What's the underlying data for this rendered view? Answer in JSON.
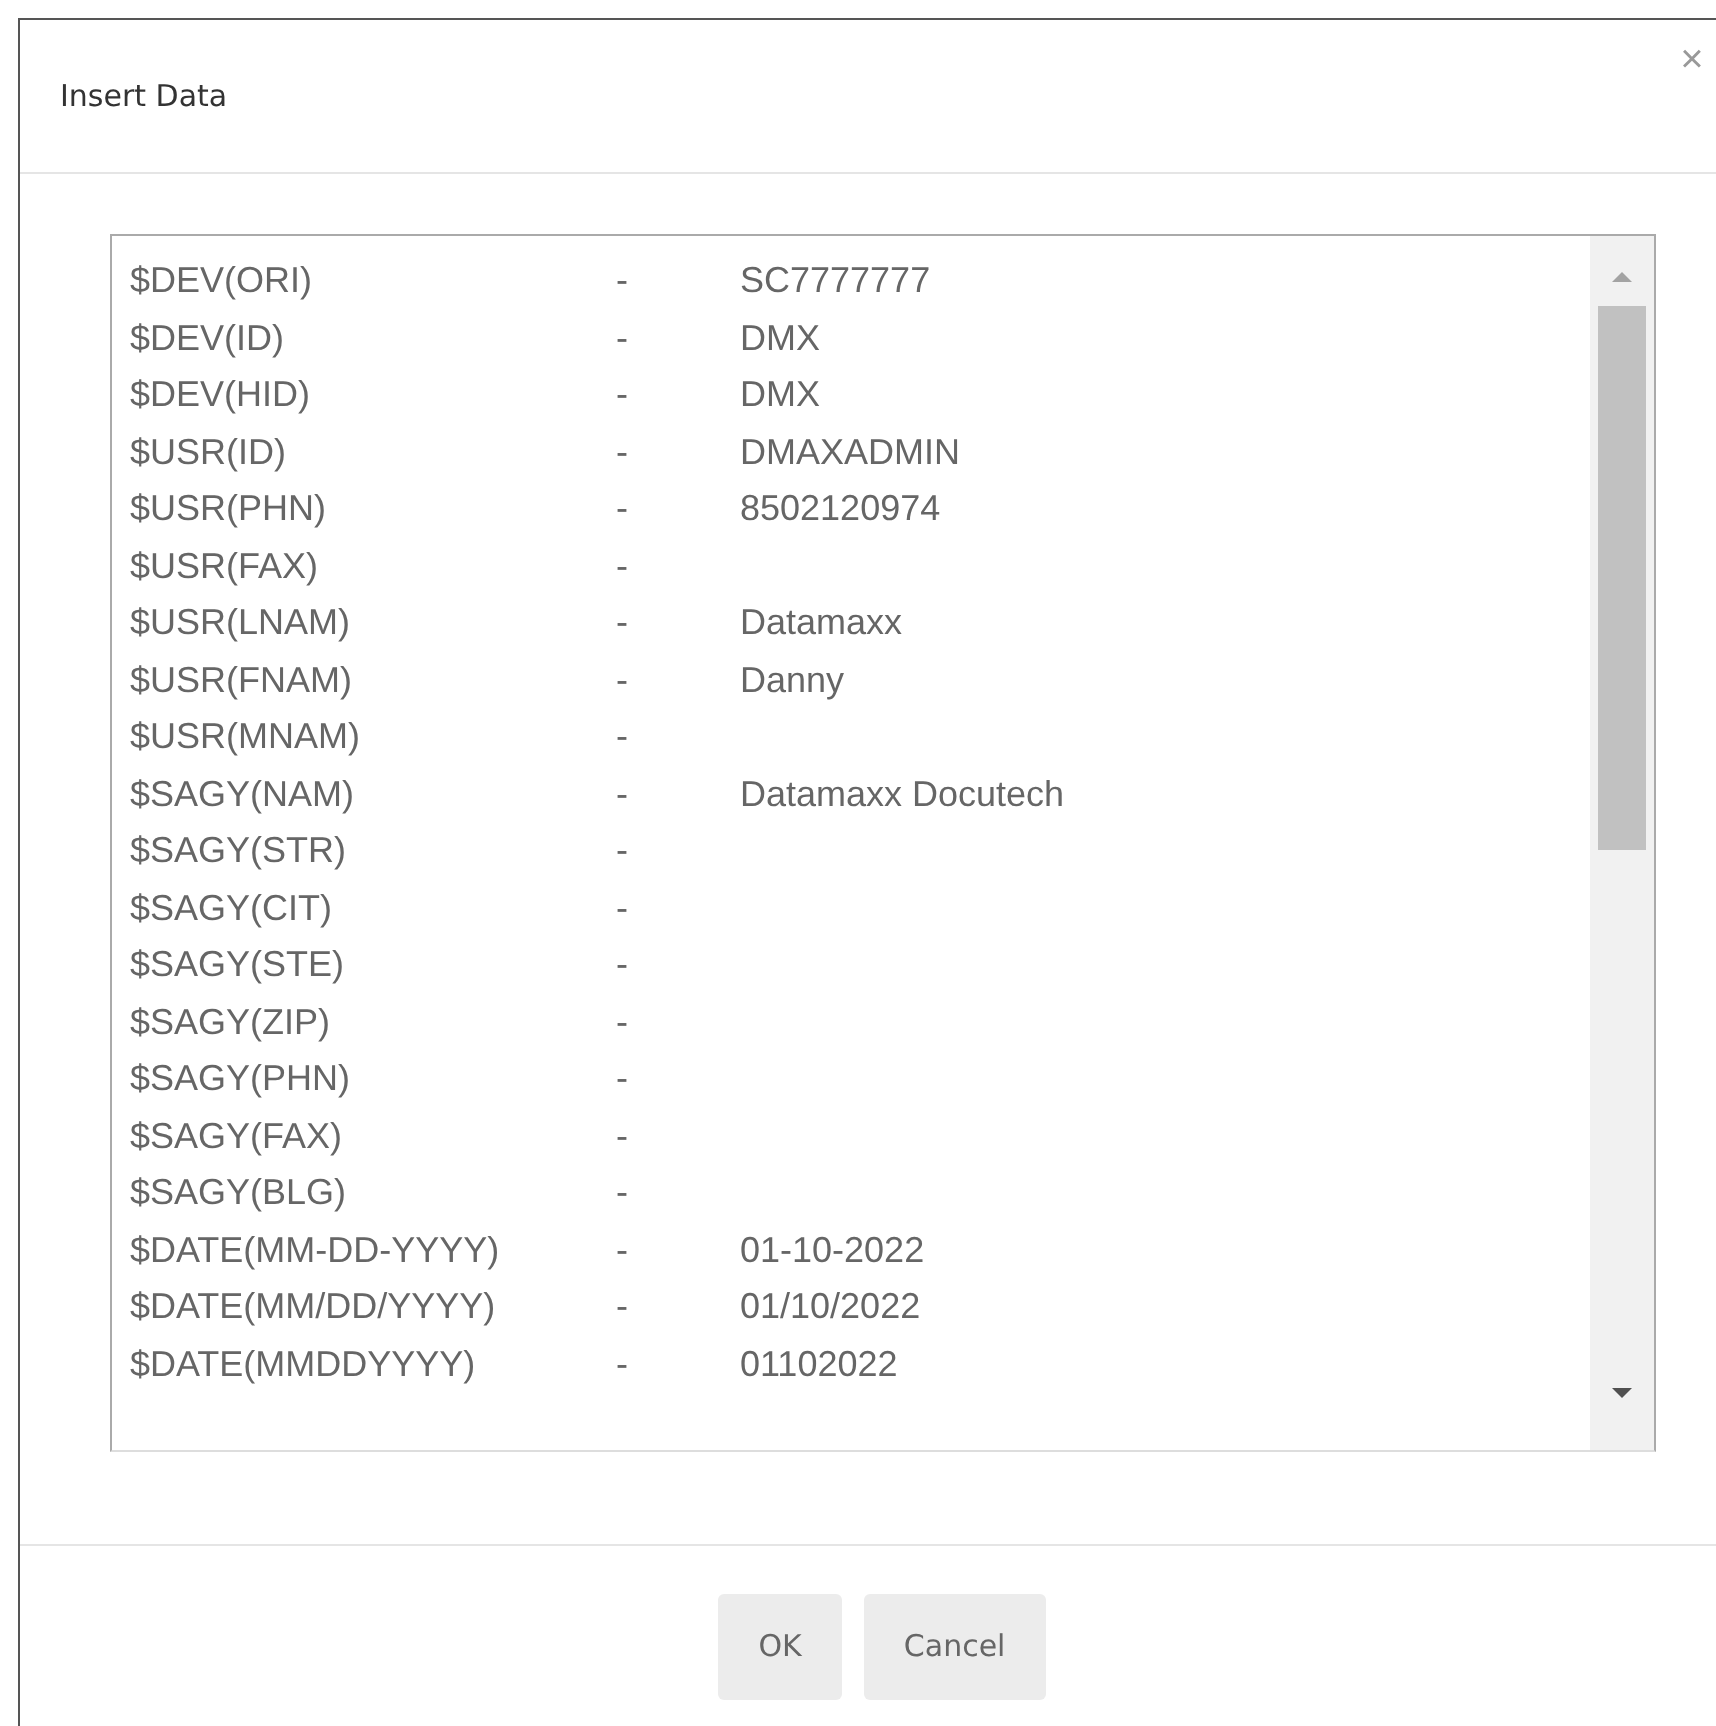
{
  "dialog": {
    "title": "Insert Data",
    "close": "×"
  },
  "list": [
    {
      "name": "$DEV(ORI)",
      "separator": "-",
      "value": "SC7777777"
    },
    {
      "name": "$DEV(ID)",
      "separator": "-",
      "value": "DMX"
    },
    {
      "name": "$DEV(HID)",
      "separator": "-",
      "value": "DMX"
    },
    {
      "name": "$USR(ID)",
      "separator": "-",
      "value": "DMAXADMIN"
    },
    {
      "name": "$USR(PHN)",
      "separator": "-",
      "value": "8502120974"
    },
    {
      "name": "$USR(FAX)",
      "separator": "-"
    },
    {
      "name": "$USR(LNAM)",
      "separator": "-",
      "value": "Datamaxx"
    },
    {
      "name": "$USR(FNAM)",
      "separator": "-",
      "value": "Danny"
    },
    {
      "name": "$USR(MNAM)",
      "separator": "-"
    },
    {
      "name": "$SAGY(NAM)",
      "separator": "-",
      "value": "Datamaxx Docutech"
    },
    {
      "name": "$SAGY(STR)",
      "separator": "-"
    },
    {
      "name": "$SAGY(CIT)",
      "separator": "-"
    },
    {
      "name": "$SAGY(STE)",
      "separator": "-"
    },
    {
      "name": "$SAGY(ZIP)",
      "separator": "-"
    },
    {
      "name": "$SAGY(PHN)",
      "separator": "-"
    },
    {
      "name": "$SAGY(FAX)",
      "separator": "-"
    },
    {
      "name": "$SAGY(BLG)",
      "separator": "-"
    },
    {
      "name": "$DATE(MM-DD-YYYY)",
      "separator": "-",
      "value": "01-10-2022"
    },
    {
      "name": "$DATE(MM/DD/YYYY)",
      "separator": "-",
      "value": "01/10/2022"
    },
    {
      "name": "$DATE(MMDDYYYY)",
      "separator": "-",
      "value": "01102022"
    }
  ],
  "buttons": [
    "OK",
    "Cancel"
  ]
}
